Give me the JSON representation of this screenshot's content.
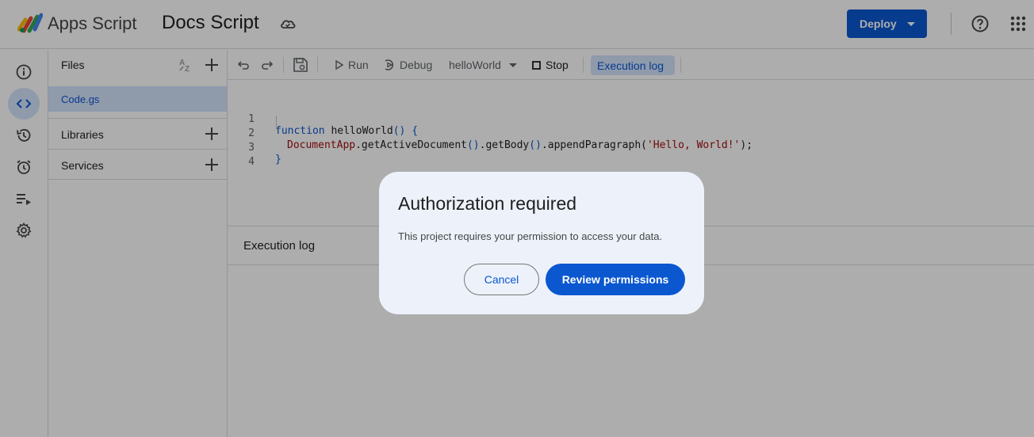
{
  "header": {
    "app_name": "Apps Script",
    "project_name": "Docs Script",
    "deploy_label": "Deploy"
  },
  "rail": {
    "icons": [
      "info-icon",
      "code-icon",
      "history-icon",
      "alarm-icon",
      "executions-icon",
      "settings-icon"
    ],
    "active_icon": "code-icon"
  },
  "files_panel": {
    "files_title": "Files",
    "files": [
      "Code.gs"
    ],
    "selected_file": "Code.gs",
    "libraries_label": "Libraries",
    "services_label": "Services"
  },
  "toolbar": {
    "run_label": "Run",
    "debug_label": "Debug",
    "function_select": "helloWorld",
    "stop_label": "Stop",
    "execution_log_label": "Execution log"
  },
  "editor": {
    "line_numbers": [
      "1",
      "2",
      "3",
      "4"
    ],
    "line1": {
      "keyword": "function",
      "name": " helloWorld",
      "parens": "()",
      "brace": " {"
    },
    "line2": {
      "class": "DocumentApp",
      "call1": ".getActiveDocument",
      "p1": "()",
      "call2": ".getBody",
      "p2": "()",
      "call3": ".appendParagraph(",
      "string": "'Hello, World!'",
      "end": ");"
    },
    "line3": {
      "brace": "}"
    }
  },
  "log_panel": {
    "title": "Execution log"
  },
  "dialog": {
    "title": "Authorization required",
    "body": "This project requires your permission to access your data.",
    "cancel_label": "Cancel",
    "review_label": "Review permissions"
  },
  "colors": {
    "accent": "#0b57d0",
    "selected_bg": "#d3e3fd",
    "dialog_bg": "#edf2fa"
  }
}
